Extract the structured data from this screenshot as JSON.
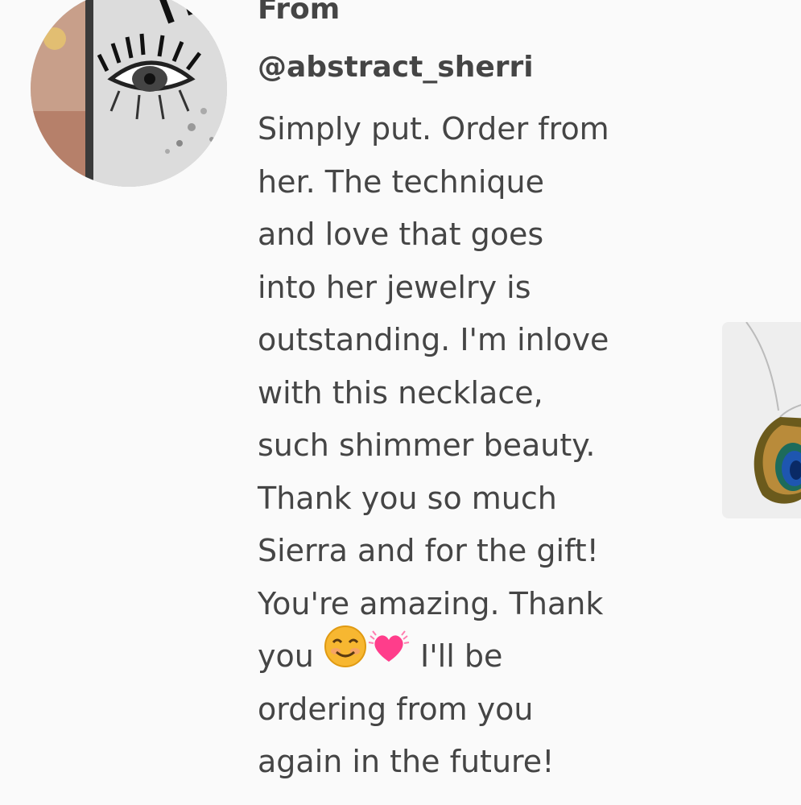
{
  "review": {
    "from_label": "From",
    "username": "@abstract_sherri",
    "lines": [
      "Simply put. Order from",
      "her. The technique",
      "and love that goes",
      "into her jewelry is",
      "outstanding. I'm inlove",
      "with this necklace,",
      "such shimmer beauty.",
      "Thank you so much",
      "Sierra and for the gift!",
      "You're amazing. Thank"
    ],
    "emoji_line": {
      "before": "you ",
      "after": " I'll be"
    },
    "lines_after": [
      "ordering from you",
      "again in the future!"
    ]
  },
  "icons": {
    "smile_emoji": "smiling-face-icon",
    "heart_emoji": "beating-heart-icon"
  },
  "colors": {
    "background": "#fafafa",
    "text": "#454545",
    "heart": "#ff3d8b",
    "smile": "#f7b731"
  }
}
